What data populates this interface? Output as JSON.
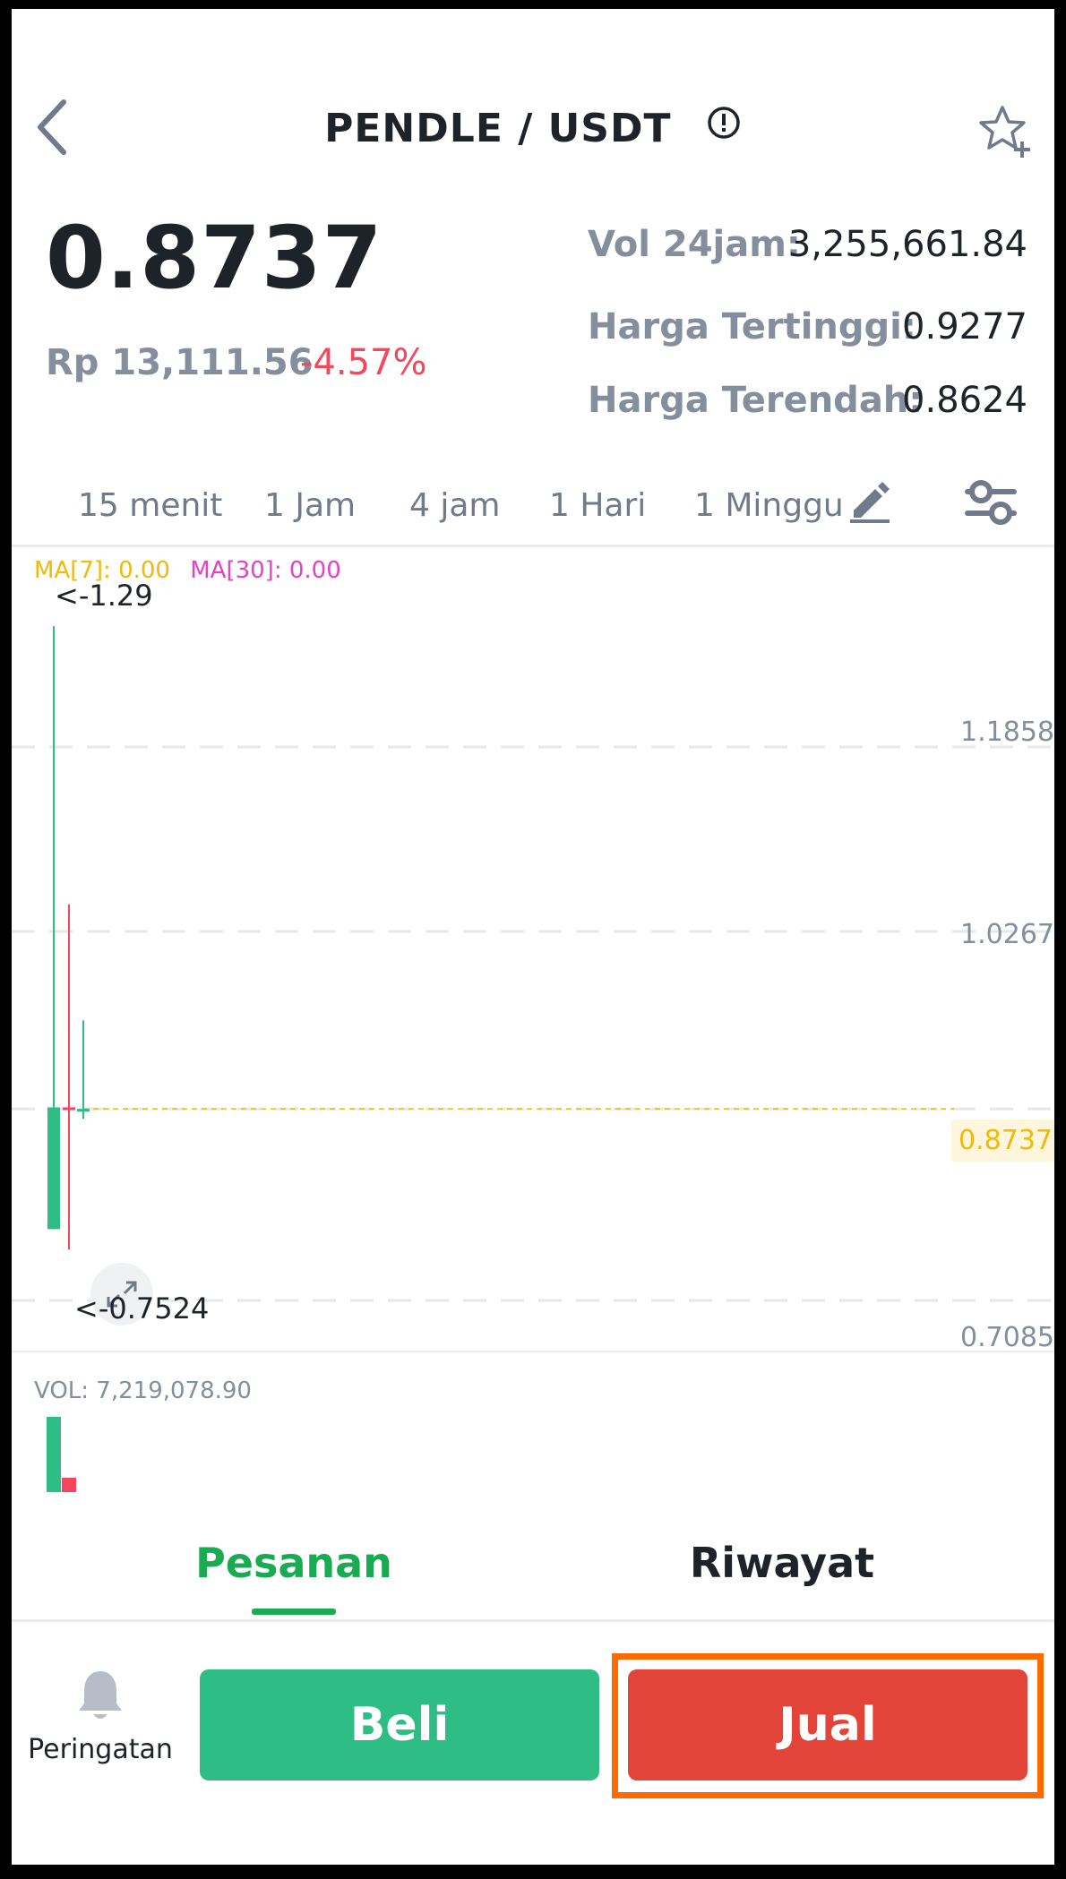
{
  "header": {
    "pair": "PENDLE / USDT"
  },
  "price": {
    "last": "0.8737",
    "fiat": "Rp 13,111.56",
    "change": "-4.57%"
  },
  "stats": [
    {
      "label": "Vol 24jam:",
      "value": "3,255,661.84"
    },
    {
      "label": "Harga Tertinggi:",
      "value": "0.9277"
    },
    {
      "label": "Harga Terendah:",
      "value": "0.8624"
    }
  ],
  "intervals": [
    "15 menit",
    "1 Jam",
    "4 jam",
    "1 Hari",
    "1 Minggu"
  ],
  "chart": {
    "ma7": "MA[7]: 0.00",
    "ma30": "MA[30]: 0.00",
    "high_marker": "<-1.29",
    "low_marker": "<-0.7524",
    "ticks": [
      "1.1858",
      "1.0267",
      "0.8737",
      "0.7085"
    ],
    "volume_label": "VOL: 7,219,078.90"
  },
  "chart_data": {
    "type": "candlestick",
    "y_axis_ticks": [
      1.1858,
      1.0267,
      0.8737,
      0.7085
    ],
    "current_price": 0.8737,
    "high_marker": 1.29,
    "low_marker": 0.7524,
    "candles": [
      {
        "open": 0.77,
        "close": 0.875,
        "high": 1.29,
        "low": 0.77,
        "direction": "up"
      },
      {
        "open": 0.875,
        "close": 0.873,
        "high": 1.05,
        "low": 0.7524,
        "direction": "down"
      },
      {
        "open": 0.873,
        "close": 0.8737,
        "high": 0.95,
        "low": 0.865,
        "direction": "up"
      }
    ],
    "volume": [
      {
        "value": 7219078.9,
        "direction": "up"
      },
      {
        "value": 1200000,
        "direction": "down"
      }
    ],
    "colors": {
      "up": "#2ebd85",
      "down": "#f6465d",
      "ma7": "#f0b90b",
      "ma30": "#e840c6"
    }
  },
  "bottom_tabs": {
    "orders": "Pesanan",
    "history": "Riwayat"
  },
  "actions": {
    "alert": "Peringatan",
    "buy": "Beli",
    "sell": "Jual"
  },
  "colors": {
    "buy": "#2ebd85",
    "sell": "#e3443a",
    "accent": "#1aaa52",
    "highlight": "#ff6a00"
  }
}
